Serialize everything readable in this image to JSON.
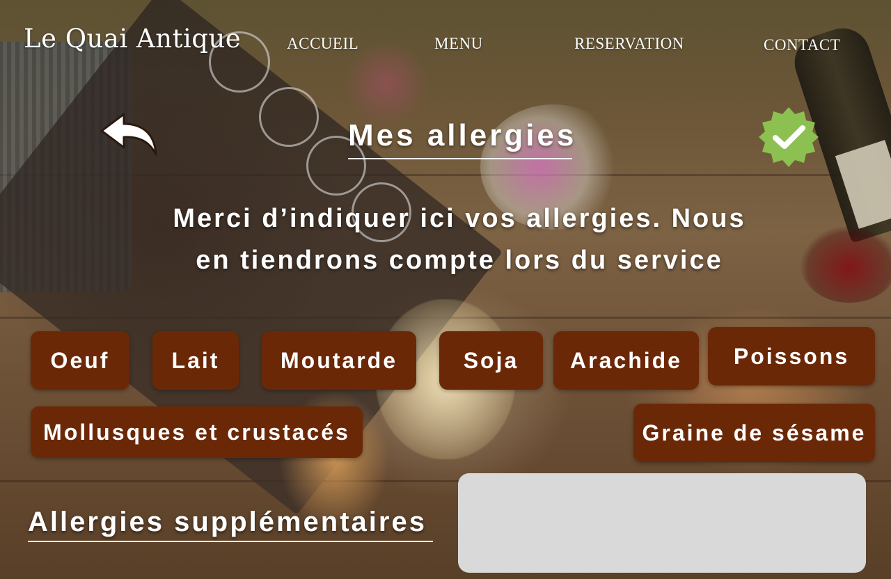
{
  "header": {
    "logo": "Le Quai Antique",
    "nav": {
      "home": "ACCUEIL",
      "menu": "MENU",
      "reservation": "RESERVATION",
      "contact": "CONTACT"
    }
  },
  "page": {
    "title": "Mes allergies",
    "intro_line1": "Merci d’indiquer ici vos allergies. Nous",
    "intro_line2": "en tiendrons compte lors du service"
  },
  "allergens": {
    "egg": "Oeuf",
    "milk": "Lait",
    "mustard": "Moutarde",
    "soy": "Soja",
    "peanut": "Arachide",
    "fish": "Poissons",
    "shellfish": "Mollusques et crustacés",
    "sesame": "Graine de sésame"
  },
  "extra": {
    "label": "Allergies supplémentaires",
    "value": ""
  },
  "icons": {
    "back": "back-arrow-icon",
    "confirm": "check-badge-icon"
  },
  "colors": {
    "button_bg": "#6b2807",
    "text": "#ffffff",
    "input_bg": "#d9d9d9",
    "confirm_green": "#8cc152"
  }
}
